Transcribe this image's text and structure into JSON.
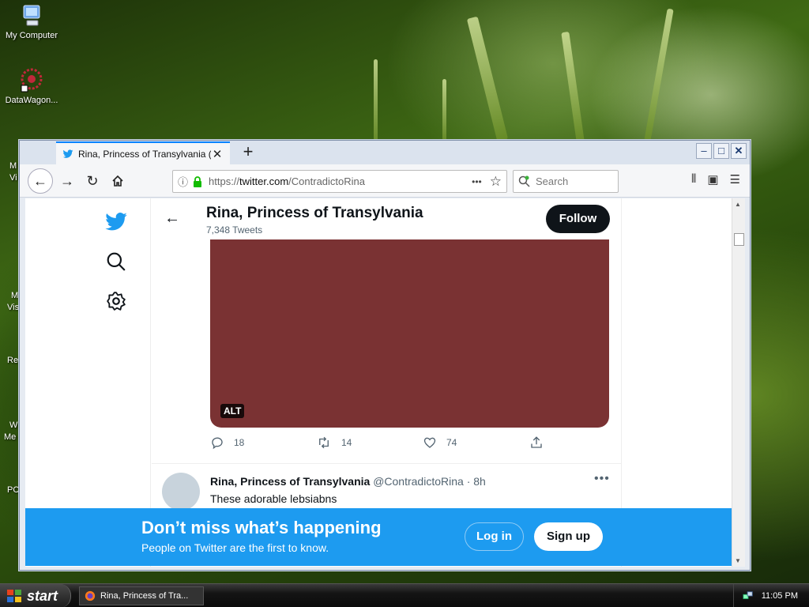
{
  "desktop": {
    "icons": [
      {
        "label": "My Computer",
        "icon": "my-computer-icon"
      },
      {
        "label": "DataWagon...",
        "icon": "datawagon-icon"
      }
    ],
    "fragments": [
      "M",
      "Vi",
      "M",
      "Vis",
      "Re",
      "W",
      "Me",
      "PC"
    ]
  },
  "browser": {
    "tab_title": "Rina, Princess of Transylvania (",
    "url_prefix": "https://",
    "url_domain": "twitter.com",
    "url_path": "/ContradictoRina",
    "search_placeholder": "Search",
    "new_tab_label": "+",
    "page_actions": "•••"
  },
  "twitter": {
    "profile_name": "Rina, Princess of Transylvania",
    "tweet_count": "7,348 Tweets",
    "follow_label": "Follow",
    "media_alt_badge": "ALT",
    "actions": {
      "replies": "18",
      "retweets": "14",
      "likes": "74"
    },
    "next_tweet": {
      "author": "Rina, Princess of Transylvania",
      "handle": "@ContradictoRina",
      "separator": "·",
      "time": "8h",
      "text": "These adorable lebsiabns",
      "more": "•••"
    },
    "banner": {
      "heading": "Don’t miss what’s happening",
      "subtext": "People on Twitter are the first to know.",
      "login_label": "Log in",
      "signup_label": "Sign up"
    },
    "colors": {
      "brand_blue": "#1d9bf0",
      "media_fill": "#7a3233",
      "follow_bg": "#0f1419"
    }
  },
  "taskbar": {
    "start_label": "start",
    "task_title": "Rina, Princess of Tra...",
    "clock": "11:05 PM"
  }
}
